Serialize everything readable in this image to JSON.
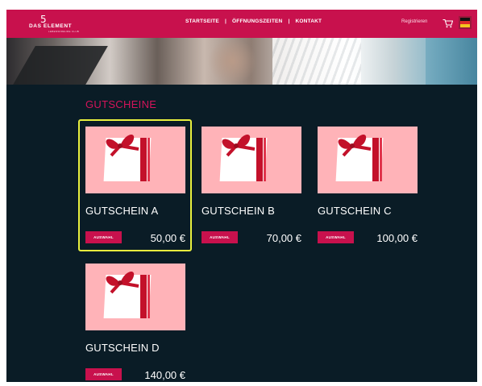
{
  "header": {
    "logo_mark": "5",
    "logo_brand": "DAS ELEMENT",
    "logo_sub": "LEBENSFREUDE CLUB",
    "nav": [
      "STARTSEITE",
      "ÖFFNUNGSZEITEN",
      "KONTAKT"
    ],
    "nav_separator": "|",
    "register_label": "Registrieren",
    "cart_icon": "cart-icon",
    "flag_icon": "german-flag-icon"
  },
  "section_title": "GUTSCHEINE",
  "colors": {
    "accent": "#c8114d",
    "title": "#d4145a",
    "background": "#0a1c26",
    "card_image": "#ffb3b8",
    "selection_outline": "#e9f03e"
  },
  "products": [
    {
      "name": "GUTSCHEIN A",
      "button_label": "AUSWAHL",
      "price": "50,00 €",
      "selected": true
    },
    {
      "name": "GUTSCHEIN B",
      "button_label": "AUSWAHL",
      "price": "70,00 €",
      "selected": false
    },
    {
      "name": "GUTSCHEIN C",
      "button_label": "AUSWAHL",
      "price": "100,00 €",
      "selected": false
    },
    {
      "name": "GUTSCHEIN D",
      "button_label": "AUSWAHL",
      "price": "140,00 €",
      "selected": false
    }
  ]
}
